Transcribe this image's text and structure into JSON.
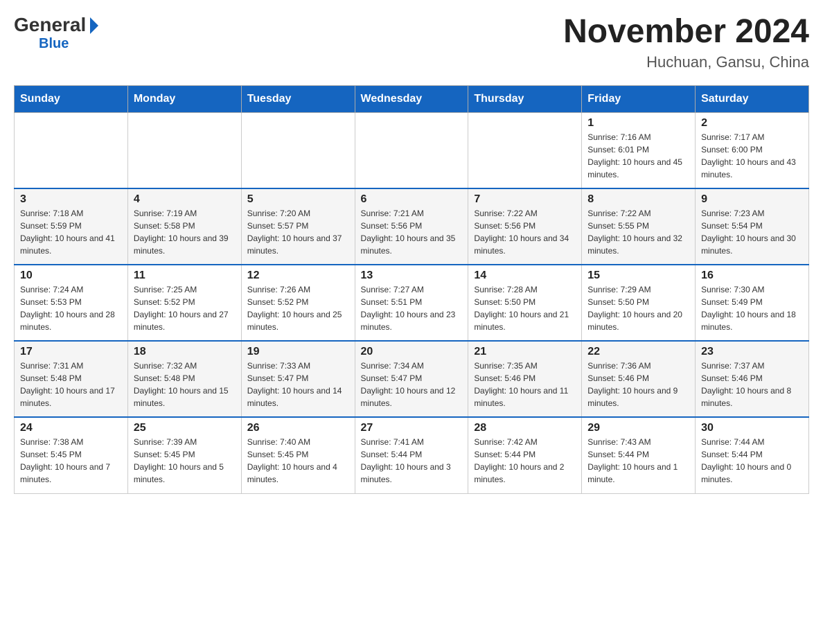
{
  "header": {
    "logo": {
      "general": "General",
      "blue": "Blue"
    },
    "title": "November 2024",
    "location": "Huchuan, Gansu, China"
  },
  "days_of_week": [
    "Sunday",
    "Monday",
    "Tuesday",
    "Wednesday",
    "Thursday",
    "Friday",
    "Saturday"
  ],
  "weeks": [
    [
      {
        "day": "",
        "info": ""
      },
      {
        "day": "",
        "info": ""
      },
      {
        "day": "",
        "info": ""
      },
      {
        "day": "",
        "info": ""
      },
      {
        "day": "",
        "info": ""
      },
      {
        "day": "1",
        "info": "Sunrise: 7:16 AM\nSunset: 6:01 PM\nDaylight: 10 hours and 45 minutes."
      },
      {
        "day": "2",
        "info": "Sunrise: 7:17 AM\nSunset: 6:00 PM\nDaylight: 10 hours and 43 minutes."
      }
    ],
    [
      {
        "day": "3",
        "info": "Sunrise: 7:18 AM\nSunset: 5:59 PM\nDaylight: 10 hours and 41 minutes."
      },
      {
        "day": "4",
        "info": "Sunrise: 7:19 AM\nSunset: 5:58 PM\nDaylight: 10 hours and 39 minutes."
      },
      {
        "day": "5",
        "info": "Sunrise: 7:20 AM\nSunset: 5:57 PM\nDaylight: 10 hours and 37 minutes."
      },
      {
        "day": "6",
        "info": "Sunrise: 7:21 AM\nSunset: 5:56 PM\nDaylight: 10 hours and 35 minutes."
      },
      {
        "day": "7",
        "info": "Sunrise: 7:22 AM\nSunset: 5:56 PM\nDaylight: 10 hours and 34 minutes."
      },
      {
        "day": "8",
        "info": "Sunrise: 7:22 AM\nSunset: 5:55 PM\nDaylight: 10 hours and 32 minutes."
      },
      {
        "day": "9",
        "info": "Sunrise: 7:23 AM\nSunset: 5:54 PM\nDaylight: 10 hours and 30 minutes."
      }
    ],
    [
      {
        "day": "10",
        "info": "Sunrise: 7:24 AM\nSunset: 5:53 PM\nDaylight: 10 hours and 28 minutes."
      },
      {
        "day": "11",
        "info": "Sunrise: 7:25 AM\nSunset: 5:52 PM\nDaylight: 10 hours and 27 minutes."
      },
      {
        "day": "12",
        "info": "Sunrise: 7:26 AM\nSunset: 5:52 PM\nDaylight: 10 hours and 25 minutes."
      },
      {
        "day": "13",
        "info": "Sunrise: 7:27 AM\nSunset: 5:51 PM\nDaylight: 10 hours and 23 minutes."
      },
      {
        "day": "14",
        "info": "Sunrise: 7:28 AM\nSunset: 5:50 PM\nDaylight: 10 hours and 21 minutes."
      },
      {
        "day": "15",
        "info": "Sunrise: 7:29 AM\nSunset: 5:50 PM\nDaylight: 10 hours and 20 minutes."
      },
      {
        "day": "16",
        "info": "Sunrise: 7:30 AM\nSunset: 5:49 PM\nDaylight: 10 hours and 18 minutes."
      }
    ],
    [
      {
        "day": "17",
        "info": "Sunrise: 7:31 AM\nSunset: 5:48 PM\nDaylight: 10 hours and 17 minutes."
      },
      {
        "day": "18",
        "info": "Sunrise: 7:32 AM\nSunset: 5:48 PM\nDaylight: 10 hours and 15 minutes."
      },
      {
        "day": "19",
        "info": "Sunrise: 7:33 AM\nSunset: 5:47 PM\nDaylight: 10 hours and 14 minutes."
      },
      {
        "day": "20",
        "info": "Sunrise: 7:34 AM\nSunset: 5:47 PM\nDaylight: 10 hours and 12 minutes."
      },
      {
        "day": "21",
        "info": "Sunrise: 7:35 AM\nSunset: 5:46 PM\nDaylight: 10 hours and 11 minutes."
      },
      {
        "day": "22",
        "info": "Sunrise: 7:36 AM\nSunset: 5:46 PM\nDaylight: 10 hours and 9 minutes."
      },
      {
        "day": "23",
        "info": "Sunrise: 7:37 AM\nSunset: 5:46 PM\nDaylight: 10 hours and 8 minutes."
      }
    ],
    [
      {
        "day": "24",
        "info": "Sunrise: 7:38 AM\nSunset: 5:45 PM\nDaylight: 10 hours and 7 minutes."
      },
      {
        "day": "25",
        "info": "Sunrise: 7:39 AM\nSunset: 5:45 PM\nDaylight: 10 hours and 5 minutes."
      },
      {
        "day": "26",
        "info": "Sunrise: 7:40 AM\nSunset: 5:45 PM\nDaylight: 10 hours and 4 minutes."
      },
      {
        "day": "27",
        "info": "Sunrise: 7:41 AM\nSunset: 5:44 PM\nDaylight: 10 hours and 3 minutes."
      },
      {
        "day": "28",
        "info": "Sunrise: 7:42 AM\nSunset: 5:44 PM\nDaylight: 10 hours and 2 minutes."
      },
      {
        "day": "29",
        "info": "Sunrise: 7:43 AM\nSunset: 5:44 PM\nDaylight: 10 hours and 1 minute."
      },
      {
        "day": "30",
        "info": "Sunrise: 7:44 AM\nSunset: 5:44 PM\nDaylight: 10 hours and 0 minutes."
      }
    ]
  ]
}
